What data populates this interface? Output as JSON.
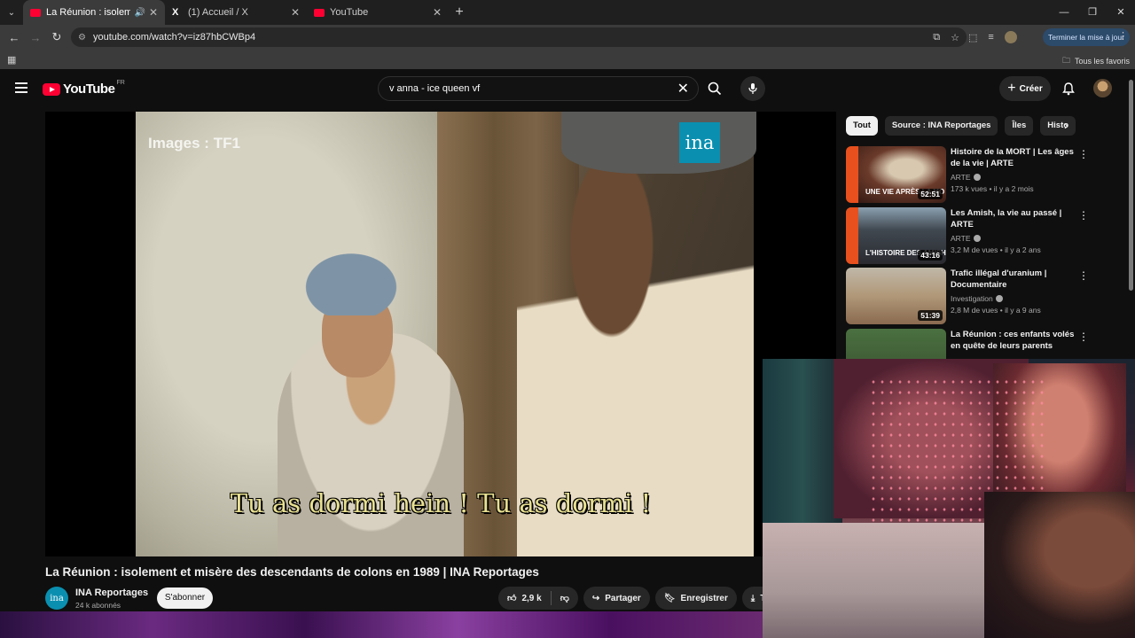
{
  "browser": {
    "tabs": [
      {
        "title": "La Réunion : isolement et m",
        "active": true
      },
      {
        "title": "(1) Accueil / X",
        "active": false
      },
      {
        "title": "YouTube",
        "active": false
      }
    ],
    "url": "youtube.com/watch?v=iz87hbCWBp4",
    "update_label": "Terminer la mise à jour",
    "bookmarks_label": "Tous les favoris"
  },
  "youtube": {
    "logo_text": "YouTube",
    "logo_region": "FR",
    "search_value": "v anna - ice queen vf",
    "create_label": "Créer"
  },
  "player": {
    "watermark": "Images : TF1",
    "logo_text": "ina",
    "subtitle": "Tu as dormi hein ! Tu as dormi !"
  },
  "video": {
    "title": "La Réunion : isolement et misère des descendants de colons en 1989 | INA Reportages",
    "channel": "INA Reportages",
    "channel_avatar_text": "ina",
    "subscribers": "24 k abonnés",
    "subscribe_label": "S'abonner",
    "likes": "2,9 k",
    "share_label": "Partager",
    "save_label": "Enregistrer",
    "download_label": "Té"
  },
  "chips": [
    "Tout",
    "Source : INA Reportages",
    "Îles",
    "Histo"
  ],
  "recommendations": [
    {
      "title": "Histoire de la MORT | Les âges de la vie | ARTE",
      "channel": "ARTE",
      "meta": "173 k vues • il y a 2 mois",
      "duration": "52:51",
      "thumb_text": "UNE VIE APRÈS LA MO"
    },
    {
      "title": "Les Amish, la vie au passé | ARTE",
      "channel": "ARTE",
      "meta": "3,2 M de vues • il y a 2 ans",
      "duration": "43:16",
      "thumb_text": "L'HISTOIRE DES AMISH"
    },
    {
      "title": "Trafic illégal d'uranium | Documentaire",
      "channel": "Investigation",
      "meta": "2,8 M de vues • il y a 9 ans",
      "duration": "51:39",
      "thumb_text": ""
    },
    {
      "title": "La Réunion : ces enfants volés en quête de leurs parents",
      "channel": "",
      "meta": "",
      "duration": "",
      "thumb_text": ""
    }
  ]
}
